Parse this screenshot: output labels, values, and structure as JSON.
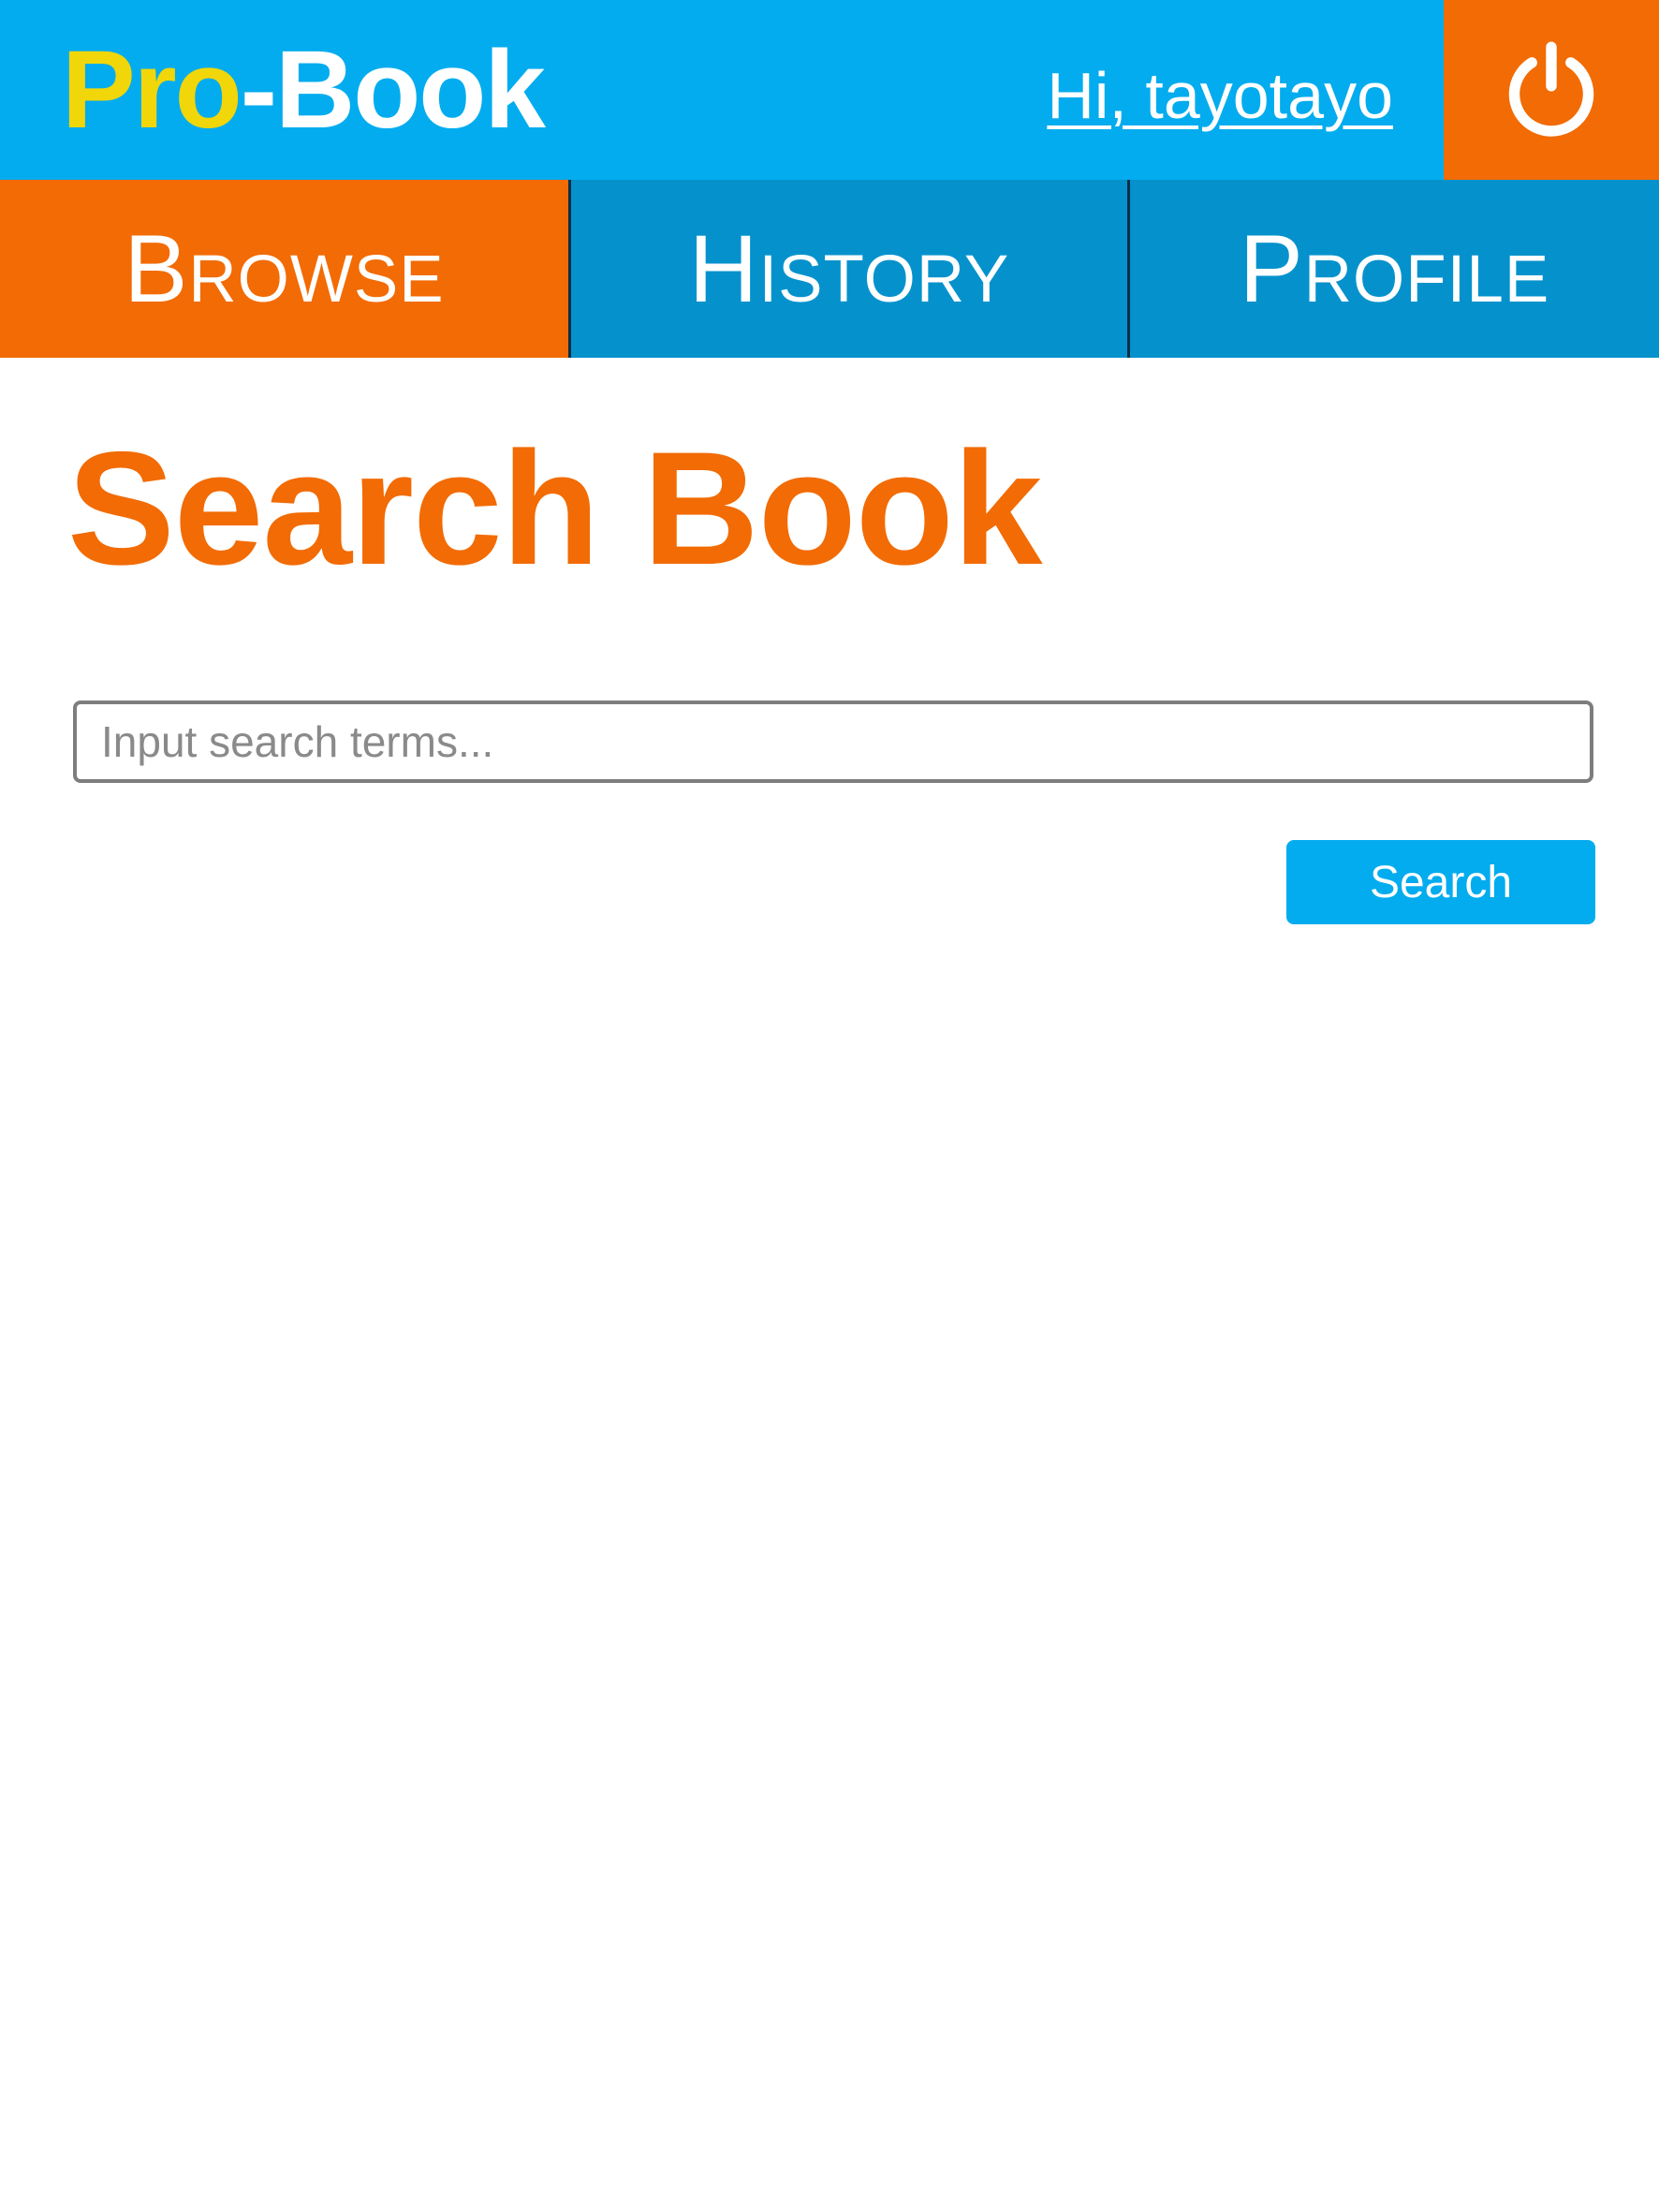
{
  "header": {
    "logo_pro": "Pro",
    "logo_dash": "-",
    "logo_book": "Book",
    "greeting": "Hi, tayotayo",
    "logout_icon": "power-icon"
  },
  "nav": {
    "tabs": [
      {
        "label": "Browse",
        "active": true
      },
      {
        "label": "History",
        "active": false
      },
      {
        "label": "Profile",
        "active": false
      }
    ]
  },
  "main": {
    "title": "Search Book",
    "search_placeholder": "Input search terms...",
    "search_value": "",
    "search_button": "Search"
  },
  "colors": {
    "primary_blue": "#03acee",
    "nav_blue": "#0592cc",
    "accent_orange": "#f26b04",
    "logo_yellow": "#f1d60a"
  }
}
